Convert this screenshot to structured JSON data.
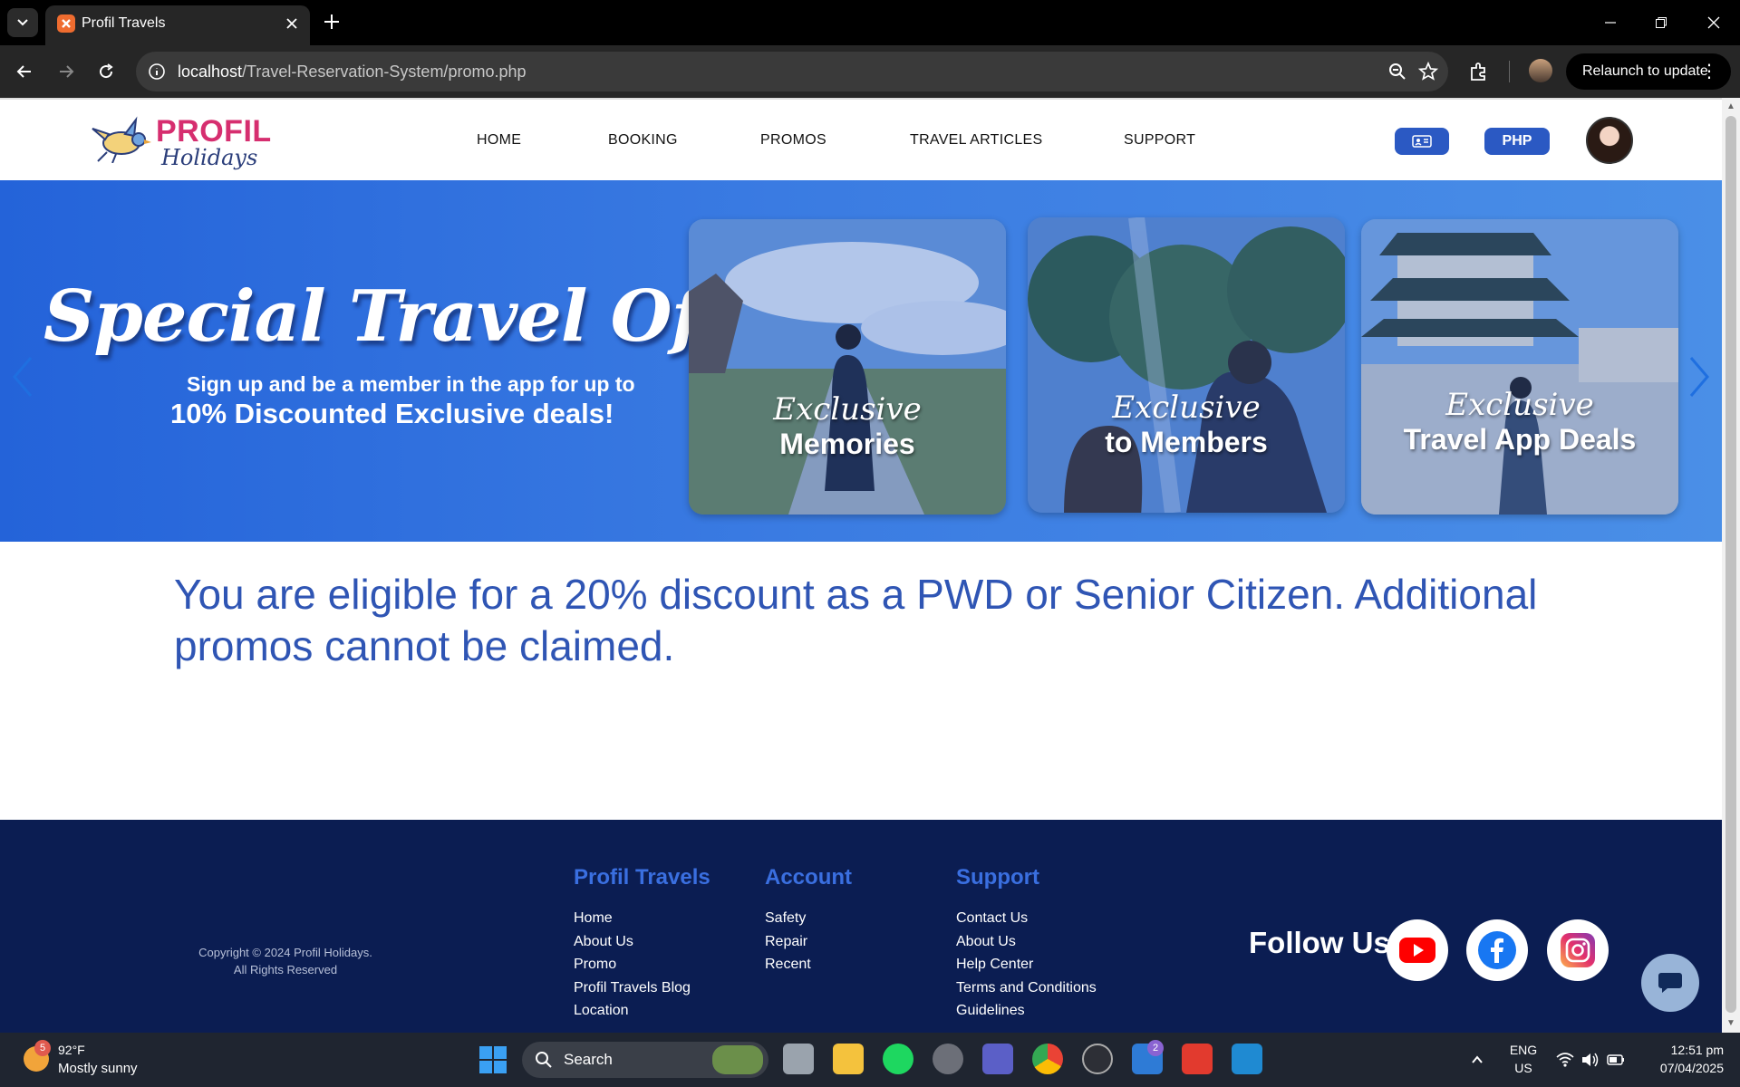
{
  "browser": {
    "tab_title": "Profil Travels",
    "url_host": "localhost",
    "url_path": "/Travel-Reservation-System/promo.php",
    "relaunch_label": "Relaunch to update"
  },
  "site": {
    "logo_word1": "PROFIL",
    "logo_word2": "Holidays",
    "nav": [
      "HOME",
      "BOOKING",
      "PROMOS",
      "TRAVEL ARTICLES",
      "SUPPORT"
    ],
    "currency_label": "PHP"
  },
  "banner": {
    "title": "Special Travel Offer",
    "subtitle_line1": "Sign up and be a member in the app for up to",
    "subtitle_line2": "10% Discounted Exclusive deals!",
    "cards": [
      {
        "line1": "Exclusive",
        "line2": "Memories"
      },
      {
        "line1": "Exclusive",
        "line2": "to Members"
      },
      {
        "line1": "Exclusive",
        "line2": "Travel App Deals"
      }
    ]
  },
  "discount_message": "You are eligible for a 20% discount as a PWD or Senior Citizen. Additional promos cannot be claimed.",
  "footer": {
    "copyright_line1": "Copyright © 2024 Profil Holidays.",
    "copyright_line2": "All Rights Reserved",
    "columns": [
      {
        "heading": "Profil Travels",
        "links": [
          "Home",
          "About Us",
          "Promo",
          "Profil Travels Blog",
          "Location"
        ]
      },
      {
        "heading": "Account",
        "links": [
          "Safety",
          "Repair",
          "Recent"
        ]
      },
      {
        "heading": "Support",
        "links": [
          "Contact Us",
          "About Us",
          "Help Center",
          "Terms and Conditions",
          "Guidelines"
        ]
      }
    ],
    "follow_label": "Follow Us"
  },
  "taskbar": {
    "weather_badge": "5",
    "weather_temp": "92°F",
    "weather_desc": "Mostly sunny",
    "search_label": "Search",
    "lang_line1": "ENG",
    "lang_line2": "US",
    "time": "12:51 pm",
    "date": "07/04/2025",
    "todo_badge": "2"
  },
  "colors": {
    "brand_pink": "#d62e6f",
    "brand_blue": "#2b59c3",
    "footer_bg": "#0b1d52",
    "message_blue": "#2f55b4"
  }
}
